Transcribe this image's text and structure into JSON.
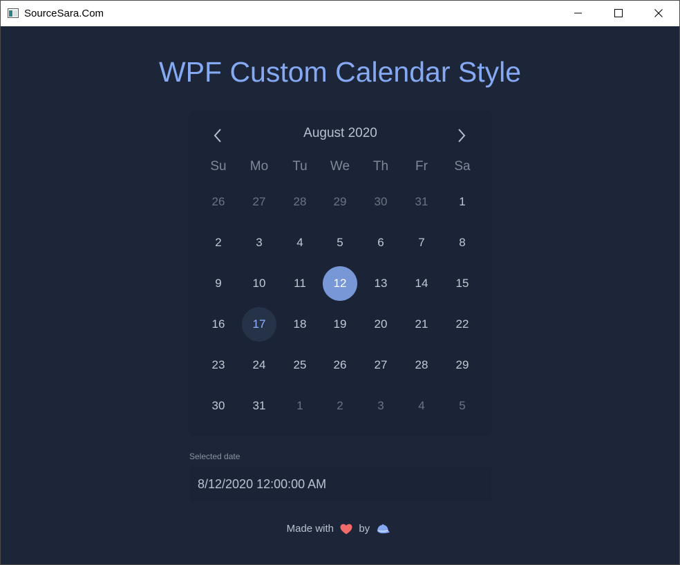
{
  "window": {
    "title": "SourceSara.Com",
    "icons": {
      "app": "application-icon",
      "minimize": "minimize-icon",
      "maximize": "maximize-icon",
      "close": "close-icon"
    }
  },
  "header": {
    "title": "WPF Custom Calendar Style",
    "color": "#86a9f4"
  },
  "calendar": {
    "month_label": "August 2020",
    "previous_icon": "chevron-left-icon",
    "next_icon": "chevron-right-icon",
    "weekdays": [
      "Su",
      "Mo",
      "Tu",
      "We",
      "Th",
      "Fr",
      "Sa"
    ],
    "days": [
      [
        "26",
        "27",
        "28",
        "29",
        "30",
        "31",
        "1"
      ],
      [
        "2",
        "3",
        "4",
        "5",
        "6",
        "7",
        "8"
      ],
      [
        "9",
        "10",
        "11",
        "12",
        "13",
        "14",
        "15"
      ],
      [
        "16",
        "17",
        "18",
        "19",
        "20",
        "21",
        "22"
      ],
      [
        "23",
        "24",
        "25",
        "26",
        "27",
        "28",
        "29"
      ],
      [
        "30",
        "31",
        "1",
        "2",
        "3",
        "4",
        "5"
      ]
    ],
    "selected_day": "12",
    "today": "17",
    "accent_color": "#7897d6",
    "today_color": "#8db3ff"
  },
  "selected": {
    "label": "Selected date",
    "value": "8/12/2020 12:00:00 AM"
  },
  "footer": {
    "made_with": "Made with",
    "by": "by",
    "heart_icon": "heart-icon",
    "author_icon": "cap-icon",
    "heart_color": "#f26b6b"
  }
}
